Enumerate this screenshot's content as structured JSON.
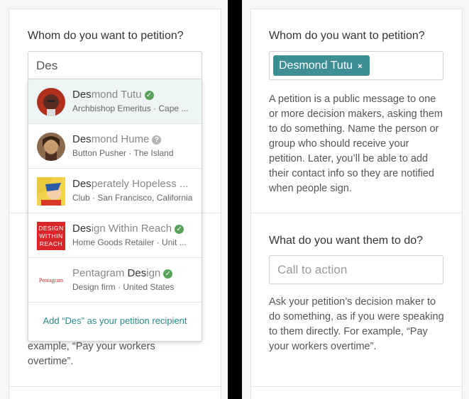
{
  "left": {
    "question": "Whom do you want to petition?",
    "search_value": "Des",
    "help_partial_line1": "example, “Pay your workers",
    "help_partial_line2": "overtime”.",
    "results": [
      {
        "match": "Des",
        "rest": "mond Tutu",
        "subtitle": "Archbishop Emeritus · Cape ...",
        "badge": "verified"
      },
      {
        "match": "Des",
        "rest": "mond Hume",
        "subtitle": "Button Pusher · The Island",
        "badge": "unknown"
      },
      {
        "match": "Des",
        "rest": "perately Hopeless ...",
        "subtitle": "Club · San Francisco, California",
        "badge": ""
      },
      {
        "match": "Des",
        "rest": "ign Within Reach",
        "subtitle": "Home Goods Retailer · Unit ...",
        "badge": "verified"
      },
      {
        "prefix": "Pentagram ",
        "match": "Des",
        "rest": "ign",
        "subtitle": "Design firm · United States",
        "badge": "verified"
      }
    ],
    "add_recipient": "Add “Des” as your petition recipient",
    "logo_dwr": [
      "DESIGN",
      "WITHIN",
      "REACH"
    ],
    "logo_pentagram": "Pentagram"
  },
  "right": {
    "question": "Whom do you want to petition?",
    "token_label": "Desmond Tutu",
    "token_remove": "×",
    "recipient_help": "A petition is a public message to one or more decision makers, asking them to do something. Name the person or group who should receive your petition. Later, you’ll be able to add their contact info so they are notified when people sign.",
    "action_question": "What do you want them to do?",
    "action_placeholder": "Call to action",
    "action_help": "Ask your petition’s decision maker to do something, as if you were speaking to them directly. For example, “Pay your workers overtime”."
  },
  "colors": {
    "accent": "#3d8f93",
    "verified": "#5aa35a",
    "link": "#2c8a8a"
  },
  "icons": {
    "verified": "check-circle-icon",
    "unknown": "question-circle-icon",
    "remove": "close-icon"
  }
}
